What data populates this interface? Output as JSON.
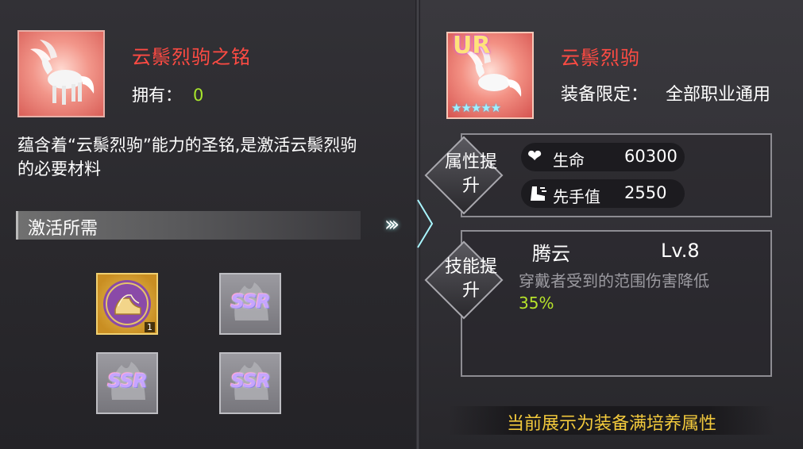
{
  "left": {
    "item_title": "云鬃烈驹之铭",
    "own_label": "拥有：",
    "own_value": "0",
    "description": "蕴含着“云鬃烈驹”能力的圣铭,是激活云鬃烈驹的必要材料",
    "requirements_title": "激活所需",
    "materials": [
      {
        "icon": "golden-boot-icon",
        "count": "1"
      },
      {
        "icon": "ssr-icon",
        "label": "SSR"
      },
      {
        "icon": "ssr-icon",
        "label": "SSR"
      },
      {
        "icon": "ssr-icon",
        "label": "SSR"
      }
    ]
  },
  "arrows": "›››",
  "right": {
    "rarity_badge": "UR",
    "stars": "★★★★★",
    "equip_title": "云鬃烈驹",
    "limit_label": "装备限定：",
    "limit_value": "全部职业通用",
    "attr_section_title": "属性提升",
    "stats": [
      {
        "icon": "heart-icon",
        "name": "生命",
        "value": "60300"
      },
      {
        "icon": "boot-icon",
        "name": "先手值",
        "value": "2550"
      }
    ],
    "skill_section_title": "技能提升",
    "skill": {
      "name": "腾云",
      "level": "Lv.8",
      "description": "穿戴者受到的范围伤害降低",
      "percent": "35%"
    },
    "footer_note": "当前展示为装备满培养属性"
  },
  "colors": {
    "title_red": "#ff4b43",
    "value_green": "#a8e62c",
    "footer_gold": "#f2c93c"
  }
}
